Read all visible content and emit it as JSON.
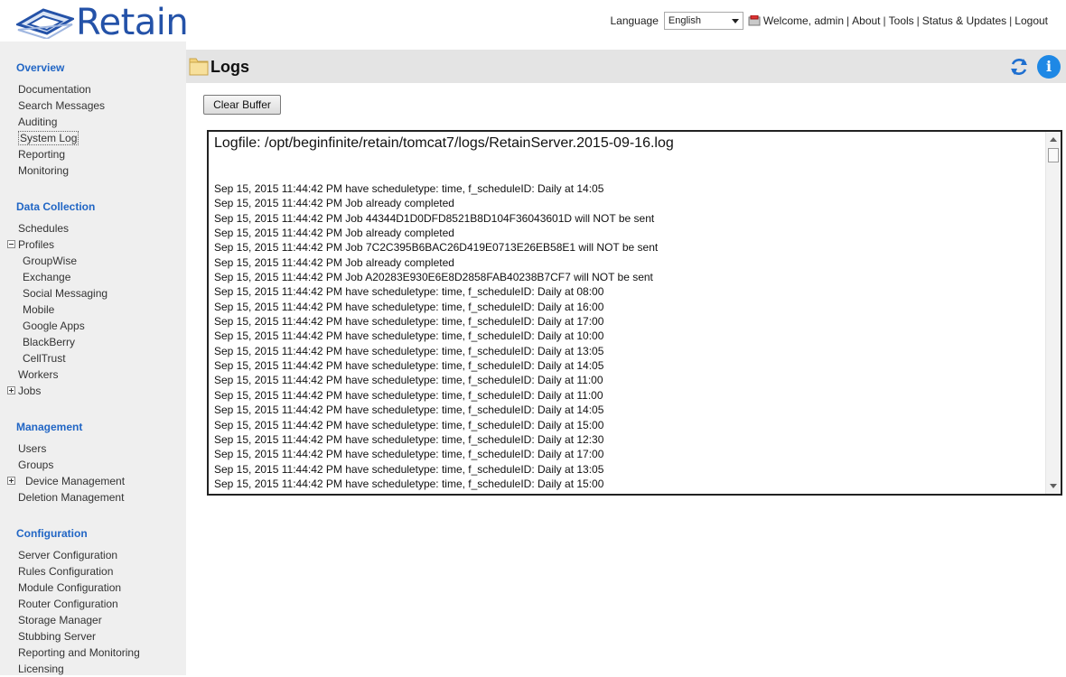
{
  "header": {
    "logo_text": "Retain",
    "language_label": "Language",
    "language_value": "English",
    "welcome": "Welcome, admin",
    "links": [
      "About",
      "Tools",
      "Status & Updates",
      "Logout"
    ],
    "separator": "|"
  },
  "sidebar": {
    "groups": [
      {
        "heading": "Overview",
        "items": [
          {
            "label": "Documentation"
          },
          {
            "label": "Search Messages"
          },
          {
            "label": "Auditing"
          },
          {
            "label": "System Log",
            "selected": true
          },
          {
            "label": "Reporting"
          },
          {
            "label": "Monitoring"
          }
        ]
      },
      {
        "heading": "Data Collection",
        "items": [
          {
            "label": "Schedules"
          },
          {
            "label": "Profiles",
            "tree": "minus"
          },
          {
            "label": "GroupWise",
            "sub": true
          },
          {
            "label": "Exchange",
            "sub": true
          },
          {
            "label": "Social Messaging",
            "sub": true
          },
          {
            "label": "Mobile",
            "sub": true
          },
          {
            "label": "Google Apps",
            "sub": true
          },
          {
            "label": "BlackBerry",
            "sub": true
          },
          {
            "label": "CellTrust",
            "sub": true
          },
          {
            "label": "Workers"
          },
          {
            "label": "Jobs",
            "tree": "plus"
          }
        ]
      },
      {
        "heading": "Management",
        "items": [
          {
            "label": "Users"
          },
          {
            "label": "Groups"
          },
          {
            "label": "Device Management",
            "tree": "plus",
            "wide": true
          },
          {
            "label": "Deletion Management"
          }
        ]
      },
      {
        "heading": "Configuration",
        "items": [
          {
            "label": "Server Configuration"
          },
          {
            "label": "Rules Configuration"
          },
          {
            "label": "Module Configuration"
          },
          {
            "label": "Router Configuration"
          },
          {
            "label": "Storage Manager"
          },
          {
            "label": "Stubbing Server"
          },
          {
            "label": "Reporting and Monitoring"
          },
          {
            "label": "Licensing"
          }
        ]
      }
    ]
  },
  "main": {
    "title": "Logs",
    "clear_button": "Clear Buffer",
    "logfile": "Logfile: /opt/beginfinite/retain/tomcat7/logs/RetainServer.2015-09-16.log",
    "lines": [
      "Sep 15, 2015 11:44:42 PM have scheduletype: time, f_scheduleID: Daily at 14:05",
      "Sep 15, 2015 11:44:42 PM Job already completed",
      "Sep 15, 2015 11:44:42 PM Job 44344D1D0DFD8521B8D104F36043601D will NOT be sent",
      "Sep 15, 2015 11:44:42 PM Job already completed",
      "Sep 15, 2015 11:44:42 PM Job 7C2C395B6BAC26D419E0713E26EB58E1 will NOT be sent",
      "Sep 15, 2015 11:44:42 PM Job already completed",
      "Sep 15, 2015 11:44:42 PM Job A20283E930E6E8D2858FAB40238B7CF7 will NOT be sent",
      "Sep 15, 2015 11:44:42 PM have scheduletype: time, f_scheduleID: Daily at 08:00",
      "Sep 15, 2015 11:44:42 PM have scheduletype: time, f_scheduleID: Daily at 16:00",
      "Sep 15, 2015 11:44:42 PM have scheduletype: time, f_scheduleID: Daily at 17:00",
      "Sep 15, 2015 11:44:42 PM have scheduletype: time, f_scheduleID: Daily at 10:00",
      "Sep 15, 2015 11:44:42 PM have scheduletype: time, f_scheduleID: Daily at 13:05",
      "Sep 15, 2015 11:44:42 PM have scheduletype: time, f_scheduleID: Daily at 14:05",
      "Sep 15, 2015 11:44:42 PM have scheduletype: time, f_scheduleID: Daily at 11:00",
      "Sep 15, 2015 11:44:42 PM have scheduletype: time, f_scheduleID: Daily at 11:00",
      "Sep 15, 2015 11:44:42 PM have scheduletype: time, f_scheduleID: Daily at 14:05",
      "Sep 15, 2015 11:44:42 PM have scheduletype: time, f_scheduleID: Daily at 15:00",
      "Sep 15, 2015 11:44:42 PM have scheduletype: time, f_scheduleID: Daily at 12:30",
      "Sep 15, 2015 11:44:42 PM have scheduletype: time, f_scheduleID: Daily at 17:00",
      "Sep 15, 2015 11:44:42 PM have scheduletype: time, f_scheduleID: Daily at 13:05",
      "Sep 15, 2015 11:44:42 PM have scheduletype: time, f_scheduleID: Daily at 15:00"
    ]
  },
  "colors": {
    "brand": "#2452a8",
    "nav_heading": "#2166c5",
    "info": "#1e88e5"
  },
  "icons": [
    "retain-logo-icon",
    "user-icon",
    "folder-icon",
    "refresh-icon",
    "info-icon"
  ]
}
